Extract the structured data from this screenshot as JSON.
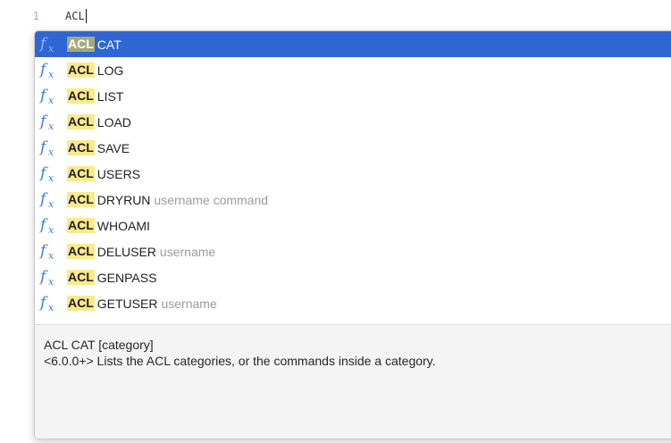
{
  "editor": {
    "line_number": "1",
    "text": "ACL"
  },
  "autocomplete": {
    "icon": "function-icon",
    "items": [
      {
        "keyword": "ACL",
        "name": "CAT",
        "args": ""
      },
      {
        "keyword": "ACL",
        "name": "LOG",
        "args": ""
      },
      {
        "keyword": "ACL",
        "name": "LIST",
        "args": ""
      },
      {
        "keyword": "ACL",
        "name": "LOAD",
        "args": ""
      },
      {
        "keyword": "ACL",
        "name": "SAVE",
        "args": ""
      },
      {
        "keyword": "ACL",
        "name": "USERS",
        "args": ""
      },
      {
        "keyword": "ACL",
        "name": "DRYRUN",
        "args": "username command"
      },
      {
        "keyword": "ACL",
        "name": "WHOAMI",
        "args": ""
      },
      {
        "keyword": "ACL",
        "name": "DELUSER",
        "args": "username"
      },
      {
        "keyword": "ACL",
        "name": "GENPASS",
        "args": ""
      },
      {
        "keyword": "ACL",
        "name": "GETUSER",
        "args": "username"
      }
    ],
    "selected_index": 0
  },
  "doc": {
    "signature": "ACL CAT [category]",
    "description": "<6.0.0+> Lists the ACL categories, or the commands inside a category."
  },
  "colors": {
    "selection": "#2f66d4",
    "match_highlight": "#fbe98d",
    "icon": "#3d7ee0",
    "hint": "#9b9b9b"
  }
}
